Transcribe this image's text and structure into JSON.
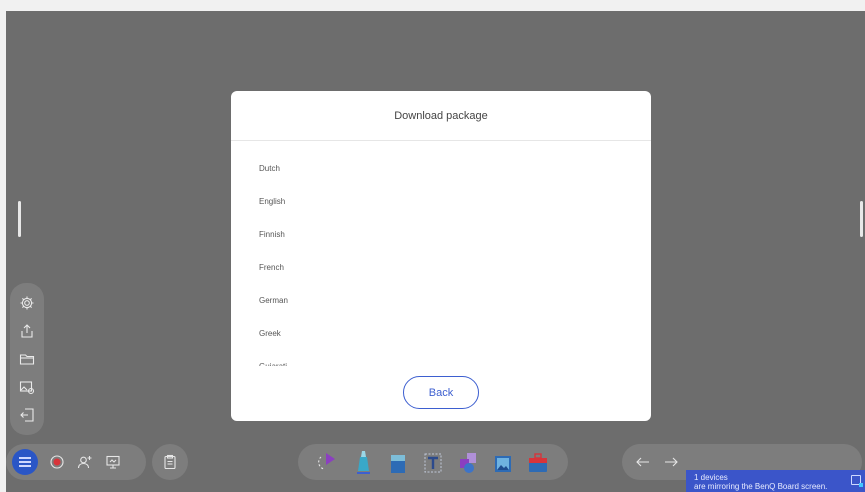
{
  "dialog": {
    "title": "Download package",
    "languages": [
      "Dutch",
      "English",
      "Finnish",
      "French",
      "German",
      "Greek",
      "Gujarati"
    ],
    "back_label": "Back"
  },
  "left_toolbar": {
    "icons": [
      "settings-icon",
      "share-icon",
      "folder-icon",
      "save-image-icon",
      "exit-icon"
    ]
  },
  "bottom_bar": {
    "left_icons": [
      "menu-icon",
      "record-icon",
      "add-user-icon",
      "present-icon"
    ],
    "doc_icon": "clipboard-icon",
    "tools": [
      "select-icon",
      "pen-icon",
      "eraser-icon",
      "text-icon",
      "shape-icon",
      "image-icon",
      "toolbox-icon"
    ],
    "right_icons": [
      "undo-icon",
      "redo-icon"
    ]
  },
  "mirror_toast": {
    "line1": "1 devices",
    "line2": "are mirroring the BenQ Board screen."
  },
  "colors": {
    "accent": "#3d5fd0",
    "background": "#6d6d6d",
    "toast": "#3b55c9"
  }
}
